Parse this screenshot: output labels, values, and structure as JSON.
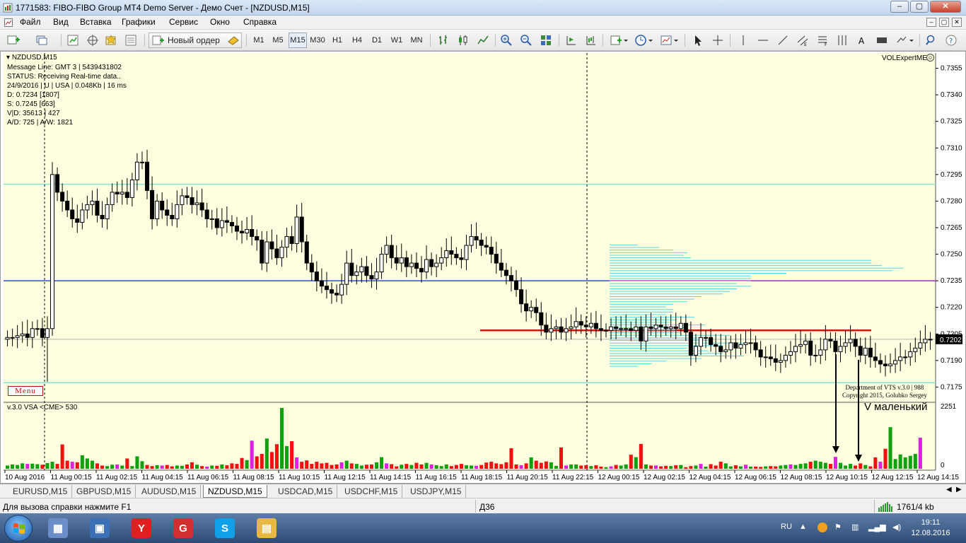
{
  "window": {
    "title": "1771583: FIBO-FIBO Group MT4 Demo Server - Демо Счет - [NZDUSD,M15]",
    "controls": {
      "minimize": "‒",
      "maximize": "▢",
      "close": "✕"
    }
  },
  "menubar": {
    "items": [
      "Файл",
      "Вид",
      "Вставка",
      "Графики",
      "Сервис",
      "Окно",
      "Справка"
    ],
    "mdi": [
      "‒",
      "▢",
      "✕"
    ]
  },
  "toolbar": {
    "new_order_label": "Новый ордер",
    "timeframes": [
      "M1",
      "M5",
      "M15",
      "M30",
      "H1",
      "H4",
      "D1",
      "W1",
      "MN"
    ],
    "active_timeframe": "M15"
  },
  "chart": {
    "symbol_label": "NZDUSD,M15",
    "info_lines": [
      "Message Line: GMT 3 | 5439431802",
      "STATUS:  Receiving Real-time data..",
      "24/9/2016 | U | USA | 0.048Kb | 16 ms",
      "D: 0.7234  [1807]",
      "S: 0.7245  [663]",
      "V|D: 35613 | 427",
      "A/D: 725 | A/W: 1821"
    ],
    "menu_button": "Menu",
    "expert_name": "VOLExpertME",
    "copyright_lines": [
      "Department of VTS  v.3.0 | 988",
      "Copyright 2015, Golubko Sergey"
    ],
    "annotation": "V маленький",
    "indicator_label": "v.3.0 VSA  <CME> 530",
    "indicator_scale": {
      "max_label": "2251",
      "min_label": "0"
    },
    "current_price": "0.7202",
    "price_ticks": [
      "0.7355",
      "0.7340",
      "0.7325",
      "0.7310",
      "0.7295",
      "0.7280",
      "0.7265",
      "0.7250",
      "0.7235",
      "0.7220",
      "0.7205",
      "0.7190",
      "0.7175"
    ],
    "time_labels": [
      "10 Aug 2016",
      "11 Aug 00:15",
      "11 Aug 02:15",
      "11 Aug 04:15",
      "11 Aug 06:15",
      "11 Aug 08:15",
      "11 Aug 10:15",
      "11 Aug 12:15",
      "11 Aug 14:15",
      "11 Aug 16:15",
      "11 Aug 18:15",
      "11 Aug 20:15",
      "11 Aug 22:15",
      "12 Aug 00:15",
      "12 Aug 02:15",
      "12 Aug 04:15",
      "12 Aug 06:15",
      "12 Aug 08:15",
      "12 Aug 10:15",
      "12 Aug 12:15",
      "12 Aug 14:15"
    ],
    "colors": {
      "background": "#ffffe0",
      "bull_candle": "#ffffff",
      "bear_candle": "#000000",
      "aqua_line": "#7fe5d0",
      "blue_line": "#3050d0",
      "red_level": "#e01010",
      "profile": "#50d8e8",
      "vol_green": "#10a010",
      "vol_red": "#f01010",
      "vol_magenta": "#e020e0"
    }
  },
  "chart_data": {
    "type": "candlestick",
    "title": "NZDUSD,M15",
    "ylim": [
      0.7168,
      0.7362
    ],
    "ohlc_open": [
      0.7202,
      0.7203,
      0.7203,
      0.7204,
      0.7205,
      0.7203,
      0.7208,
      0.7208,
      0.7203,
      0.7208,
      0.7295,
      0.7285,
      0.728,
      0.7275,
      0.727,
      0.7268,
      0.7275,
      0.7278,
      0.728,
      0.7272,
      0.727,
      0.7278,
      0.7285,
      0.7284,
      0.7285,
      0.7282,
      0.7292,
      0.7302,
      0.7302,
      0.7286,
      0.727,
      0.728,
      0.7275,
      0.7272,
      0.727,
      0.7278,
      0.7283,
      0.7282,
      0.7278,
      0.7279,
      0.7275,
      0.727,
      0.727,
      0.7265,
      0.7269,
      0.7268,
      0.7266,
      0.7263,
      0.7262,
      0.7264,
      0.726,
      0.7258,
      0.7245,
      0.7257,
      0.7253,
      0.7248,
      0.7254,
      0.726,
      0.7256,
      0.7271,
      0.7257,
      0.7245,
      0.724,
      0.7235,
      0.7232,
      0.723,
      0.7228,
      0.7227,
      0.7233,
      0.7245,
      0.7238,
      0.724,
      0.7243,
      0.7238,
      0.7236,
      0.724,
      0.725,
      0.7255,
      0.7248,
      0.7245,
      0.7248,
      0.7243,
      0.7245,
      0.7242,
      0.724,
      0.7247,
      0.7243,
      0.7245,
      0.7248,
      0.7252,
      0.725,
      0.7248,
      0.7247,
      0.7255,
      0.726,
      0.7258,
      0.7255,
      0.7254,
      0.725,
      0.7245,
      0.7241,
      0.7238,
      0.7235,
      0.723,
      0.7222,
      0.7218,
      0.722,
      0.7217,
      0.721,
      0.7206,
      0.7208,
      0.7209,
      0.7206,
      0.7208,
      0.7209,
      0.7212,
      0.721,
      0.7209,
      0.7211,
      0.7208,
      0.7207,
      0.7207,
      0.7209,
      0.7208,
      0.7208,
      0.7208,
      0.7207,
      0.7209,
      0.7201,
      0.7209,
      0.7208,
      0.721,
      0.7209,
      0.7208,
      0.7209,
      0.7208,
      0.7211,
      0.7206,
      0.7193,
      0.7198,
      0.7203,
      0.7203,
      0.7199,
      0.7198,
      0.7195,
      0.7196,
      0.72,
      0.7197,
      0.7199,
      0.72,
      0.72,
      0.7196,
      0.7192,
      0.7192,
      0.7191,
      0.7189,
      0.719,
      0.7193,
      0.7195,
      0.7198,
      0.7199,
      0.7201,
      0.7193,
      0.7193,
      0.7196,
      0.7202,
      0.7201,
      0.7195,
      0.7198,
      0.72,
      0.7202,
      0.7198,
      0.7193,
      0.7197,
      0.7192,
      0.719,
      0.7188,
      0.7187,
      0.7188,
      0.719,
      0.7192,
      0.7192,
      0.7195,
      0.7197,
      0.72,
      0.7202
    ],
    "ohlc_close": [
      0.7203,
      0.7203,
      0.7204,
      0.7205,
      0.7203,
      0.7208,
      0.7208,
      0.7203,
      0.7208,
      0.7295,
      0.7285,
      0.728,
      0.7275,
      0.727,
      0.7268,
      0.7275,
      0.7278,
      0.728,
      0.7272,
      0.727,
      0.7278,
      0.7285,
      0.7284,
      0.7285,
      0.7282,
      0.7292,
      0.7302,
      0.7302,
      0.7286,
      0.727,
      0.728,
      0.7275,
      0.7272,
      0.727,
      0.7278,
      0.7283,
      0.7282,
      0.7278,
      0.7279,
      0.7275,
      0.727,
      0.727,
      0.7265,
      0.7269,
      0.7268,
      0.7266,
      0.7263,
      0.7262,
      0.7264,
      0.726,
      0.7258,
      0.7245,
      0.7257,
      0.7253,
      0.7248,
      0.7254,
      0.726,
      0.7256,
      0.7271,
      0.7257,
      0.7245,
      0.724,
      0.7235,
      0.7232,
      0.723,
      0.7228,
      0.7227,
      0.7233,
      0.7245,
      0.7238,
      0.724,
      0.7243,
      0.7238,
      0.7236,
      0.724,
      0.725,
      0.7255,
      0.7248,
      0.7245,
      0.7248,
      0.7243,
      0.7245,
      0.7242,
      0.724,
      0.7247,
      0.7243,
      0.7245,
      0.7248,
      0.7252,
      0.725,
      0.7248,
      0.7247,
      0.7255,
      0.726,
      0.7258,
      0.7255,
      0.7254,
      0.725,
      0.7245,
      0.7241,
      0.7238,
      0.7235,
      0.723,
      0.7222,
      0.7218,
      0.722,
      0.7217,
      0.721,
      0.7206,
      0.7208,
      0.7209,
      0.7206,
      0.7208,
      0.7209,
      0.7212,
      0.721,
      0.7209,
      0.7211,
      0.7208,
      0.7207,
      0.7207,
      0.7209,
      0.7208,
      0.7208,
      0.7208,
      0.7207,
      0.7209,
      0.7201,
      0.7209,
      0.7208,
      0.721,
      0.7209,
      0.7208,
      0.7209,
      0.7208,
      0.7211,
      0.7206,
      0.7193,
      0.7198,
      0.7203,
      0.7203,
      0.7199,
      0.7198,
      0.7195,
      0.7196,
      0.72,
      0.7197,
      0.7199,
      0.72,
      0.72,
      0.7196,
      0.7192,
      0.7192,
      0.7191,
      0.7189,
      0.719,
      0.7193,
      0.7195,
      0.7198,
      0.7199,
      0.7201,
      0.7193,
      0.7193,
      0.7196,
      0.7202,
      0.7201,
      0.7195,
      0.7198,
      0.72,
      0.7202,
      0.7198,
      0.7193,
      0.7197,
      0.7192,
      0.719,
      0.7188,
      0.7187,
      0.7188,
      0.719,
      0.7192,
      0.7192,
      0.7195,
      0.7197,
      0.72,
      0.7202,
      0.7202
    ],
    "volume": [
      120,
      160,
      140,
      200,
      180,
      190,
      170,
      150,
      210,
      260,
      180,
      900,
      300,
      260,
      240,
      500,
      380,
      300,
      200,
      120,
      100,
      150,
      160,
      120,
      380,
      100,
      460,
      280,
      140,
      100,
      130,
      120,
      140,
      90,
      120,
      110,
      160,
      240,
      150,
      100,
      80,
      120,
      110,
      160,
      130,
      200,
      180,
      400,
      320,
      1040,
      460,
      550,
      1120,
      620,
      910,
      2251,
      840,
      1020,
      420,
      260,
      310,
      180,
      260,
      200,
      220,
      140,
      160,
      240,
      300,
      200,
      180,
      120,
      150,
      160,
      240,
      430,
      200,
      170,
      90,
      150,
      180,
      140,
      220,
      160,
      220,
      160,
      130,
      100,
      160,
      100,
      140,
      180,
      130,
      120,
      110,
      140,
      230,
      260,
      200,
      170,
      240,
      760,
      160,
      130,
      200,
      420,
      300,
      220,
      270,
      240,
      110,
      790,
      120,
      160,
      160,
      120,
      130,
      100,
      130,
      80,
      60,
      90,
      140,
      120,
      160,
      520,
      430,
      920,
      160,
      120,
      120,
      90,
      110,
      100,
      130,
      140,
      60,
      100,
      120,
      180,
      80,
      170,
      120,
      260,
      200,
      90,
      130,
      90,
      150,
      80,
      80,
      70,
      90,
      100,
      90,
      120,
      140,
      160,
      140,
      180,
      200,
      260,
      300,
      260,
      220,
      180,
      440,
      220,
      120,
      180,
      120,
      200,
      140,
      90,
      420,
      260,
      740,
      1540,
      360,
      530,
      420,
      480,
      550,
      1150
    ]
  },
  "tabs": {
    "items": [
      "EURUSD,M15",
      "GBPUSD,M15",
      "AUDUSD,M15",
      "NZDUSD,M15",
      "USDCAD,M15",
      "USDCHF,M15",
      "USDJPY,M15"
    ],
    "active": "NZDUSD,M15"
  },
  "statusbar": {
    "help": "Для вызова справки нажмите F1",
    "profile": "Д36",
    "traffic": "1761/4 kb"
  },
  "taskbar": {
    "lang": "RU",
    "time": "19:11",
    "date": "12.08.2016",
    "icons": [
      {
        "name": "Калькулятор",
        "color": "#6b8ec8",
        "glyph": "▦"
      },
      {
        "name": "Компьютер",
        "color": "#3b6fb8",
        "glyph": "▣"
      },
      {
        "name": "Yandex",
        "color": "#e02020",
        "glyph": "Y"
      },
      {
        "name": "FIBO Group",
        "color": "#d03030",
        "glyph": "G"
      },
      {
        "name": "Skype",
        "color": "#10a0e8",
        "glyph": "S"
      },
      {
        "name": "Проводник",
        "color": "#e8b840",
        "glyph": "▤"
      }
    ]
  }
}
